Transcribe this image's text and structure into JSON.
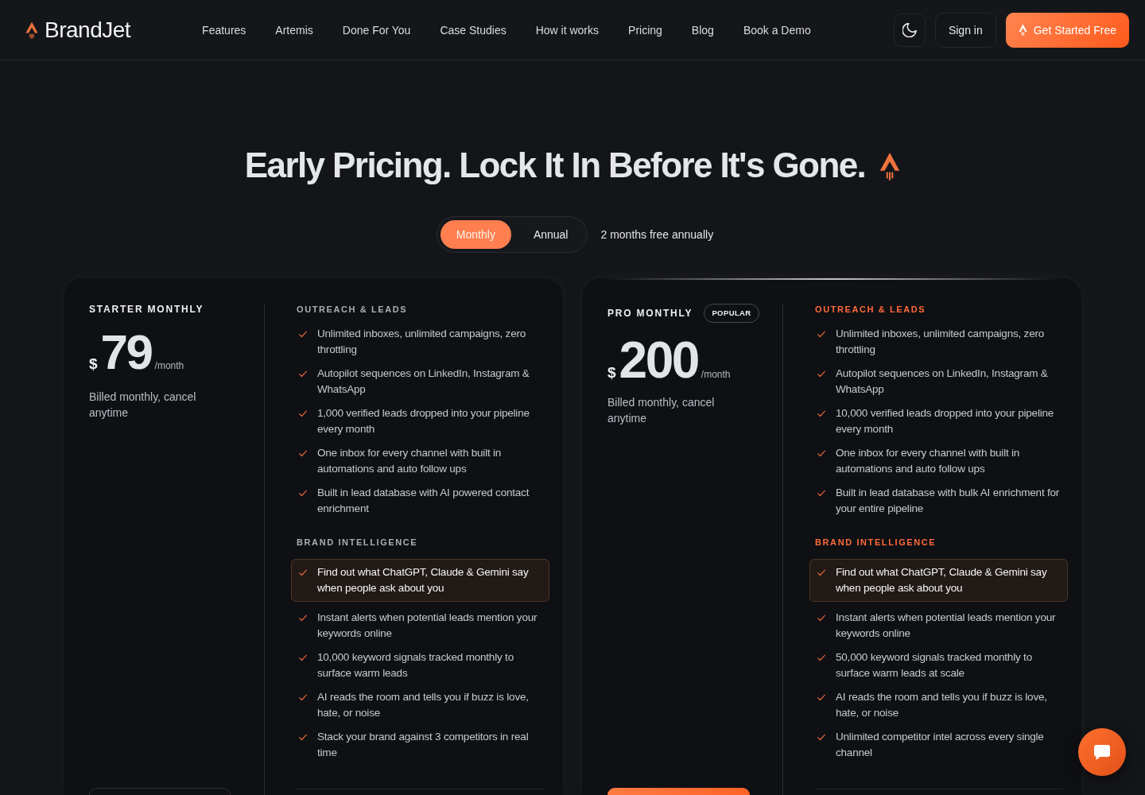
{
  "brand": "BrandJet",
  "nav": [
    "Features",
    "Artemis",
    "Done For You",
    "Case Studies",
    "How it works",
    "Pricing",
    "Blog",
    "Book a Demo"
  ],
  "header_buttons": {
    "sign_in": "Sign in",
    "get_started": "Get Started Free"
  },
  "hero": {
    "title": "Early Pricing. Lock It In Before It's Gone."
  },
  "billing_toggle": {
    "options": [
      {
        "label": "Monthly",
        "selected": true
      },
      {
        "label": "Annual",
        "selected": false
      }
    ],
    "note": "2 months free annually"
  },
  "plans": [
    {
      "name": "STARTER MONTHLY",
      "featured": false,
      "currency": "$",
      "price": "79",
      "period": "/month",
      "billing_note": "Billed monthly, cancel anytime",
      "sections": [
        {
          "title": "OUTREACH & LEADS",
          "items": [
            {
              "text": "Unlimited inboxes, unlimited campaigns, zero throttling",
              "highlighted": false
            },
            {
              "text": "Autopilot sequences on LinkedIn, Instagram & WhatsApp",
              "highlighted": false
            },
            {
              "text": "1,000 verified leads dropped into your pipeline every month",
              "highlighted": false
            },
            {
              "text": "One inbox for every channel with built in automations and auto follow ups",
              "highlighted": false
            },
            {
              "text": "Built in lead database with AI powered contact enrichment",
              "highlighted": false
            }
          ]
        },
        {
          "title": "BRAND INTELLIGENCE",
          "items": [
            {
              "text": "Find out what ChatGPT, Claude & Gemini say when people ask about you",
              "highlighted": true
            },
            {
              "text": "Instant alerts when potential leads mention your keywords online",
              "highlighted": false
            },
            {
              "text": "10,000 keyword signals tracked monthly to surface warm leads",
              "highlighted": false
            },
            {
              "text": "AI reads the room and tells you if buzz is love, hate, or noise",
              "highlighted": false
            },
            {
              "text": "Stack your brand against 3 competitors in real time",
              "highlighted": false
            }
          ]
        }
      ]
    },
    {
      "name": "PRO MONTHLY",
      "badge": "POPULAR",
      "featured": true,
      "currency": "$",
      "price": "200",
      "period": "/month",
      "billing_note": "Billed monthly, cancel anytime",
      "sections": [
        {
          "title": "OUTREACH & LEADS",
          "items": [
            {
              "text": "Unlimited inboxes, unlimited campaigns, zero throttling",
              "highlighted": false
            },
            {
              "text": "Autopilot sequences on LinkedIn, Instagram & WhatsApp",
              "highlighted": false
            },
            {
              "text": "10,000 verified leads dropped into your pipeline every month",
              "highlighted": false
            },
            {
              "text": "One inbox for every channel with built in automations and auto follow ups",
              "highlighted": false
            },
            {
              "text": "Built in lead database with bulk AI enrichment for your entire pipeline",
              "highlighted": false
            }
          ]
        },
        {
          "title": "BRAND INTELLIGENCE",
          "items": [
            {
              "text": "Find out what ChatGPT, Claude & Gemini say when people ask about you",
              "highlighted": true
            },
            {
              "text": "Instant alerts when potential leads mention your keywords online",
              "highlighted": false
            },
            {
              "text": "50,000 keyword signals tracked monthly to surface warm leads at scale",
              "highlighted": false
            },
            {
              "text": "AI reads the room and tells you if buzz is love, hate, or noise",
              "highlighted": false
            },
            {
              "text": "Unlimited competitor intel across every single channel",
              "highlighted": false
            }
          ]
        }
      ]
    }
  ]
}
